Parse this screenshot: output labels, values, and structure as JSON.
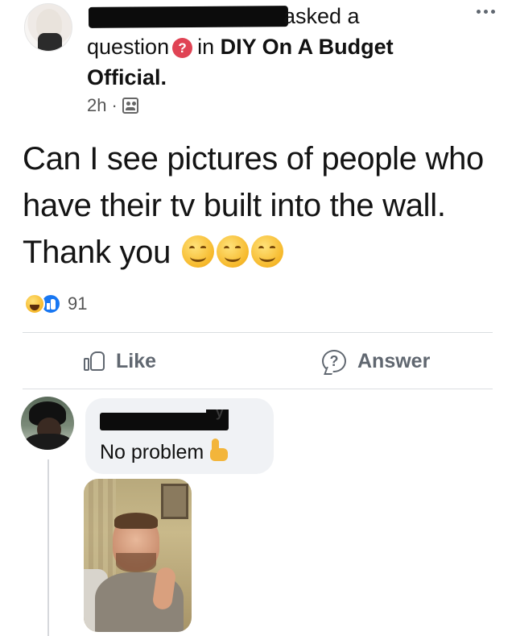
{
  "post": {
    "verb_text": "asked a",
    "question_word": "question",
    "question_badge": "?",
    "in_text": "in",
    "group_name": "DIY On A Budget",
    "group_suffix": "Official.",
    "time_ago": "2h",
    "dot": "·",
    "audience_icon": "group-audience-icon",
    "body_text": "Can I see pictures of people who have their tv built into the wall. Thank you",
    "emoji_count": 3
  },
  "reactions": {
    "types": [
      "haha",
      "like"
    ],
    "count": "91"
  },
  "actions": {
    "like_label": "Like",
    "answer_label": "Answer",
    "answer_icon_glyph": "?"
  },
  "comment": {
    "name_fragment": "y",
    "text": "No problem",
    "emoji": "thumbs-up"
  },
  "colors": {
    "question_badge": "#e04354",
    "like_blue": "#1877f2",
    "action_gray": "#606770",
    "bubble_bg": "#f0f2f5"
  }
}
